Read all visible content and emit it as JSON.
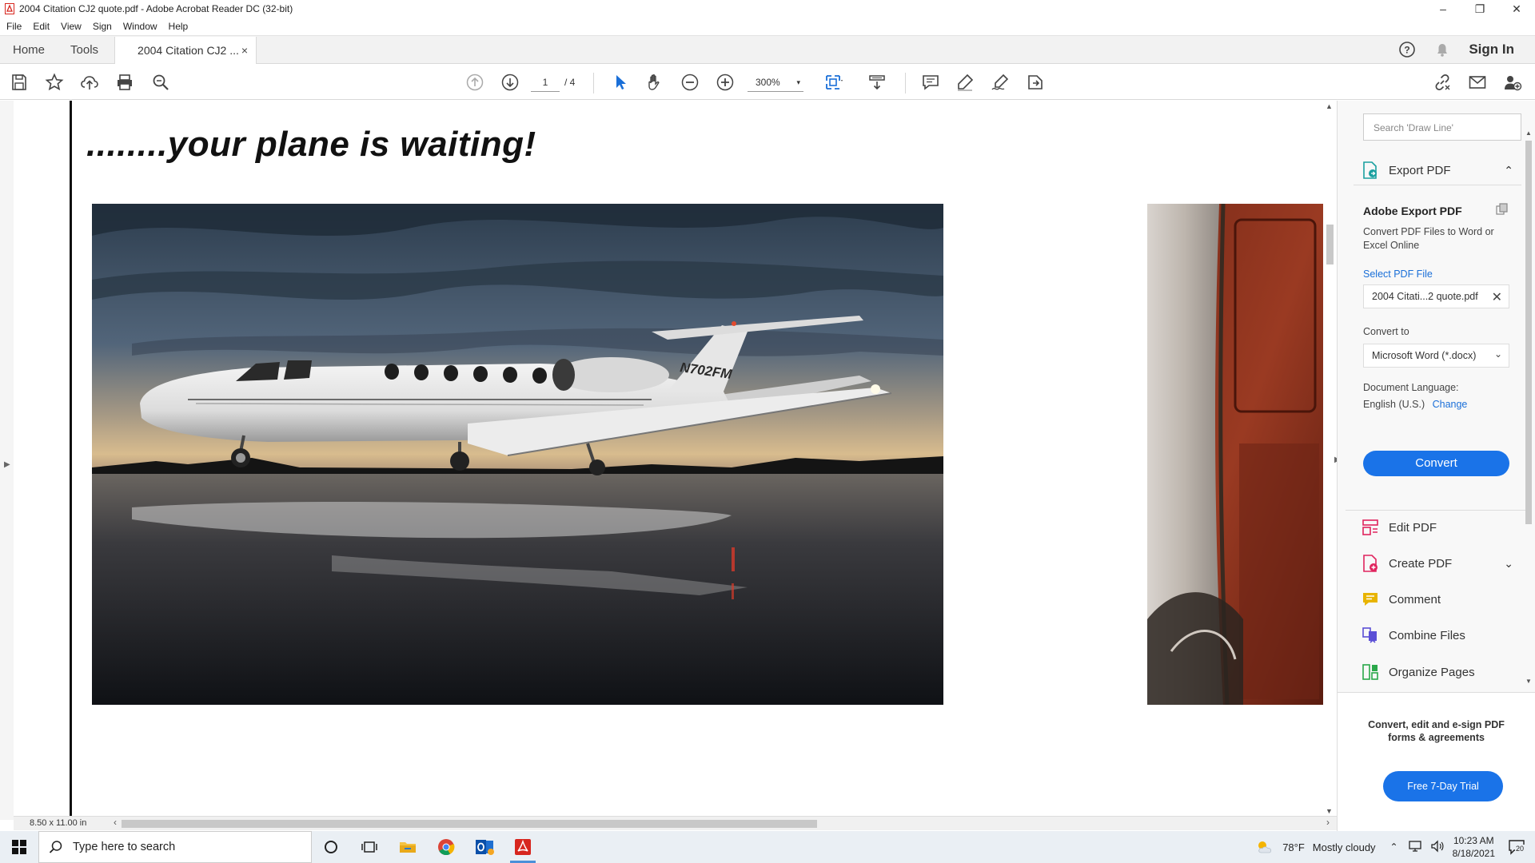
{
  "window": {
    "title": "2004 Citation CJ2 quote.pdf - Adobe Acrobat Reader DC (32-bit)",
    "minimize": "–",
    "maximize": "❐",
    "close": "✕"
  },
  "menu": [
    "File",
    "Edit",
    "View",
    "Sign",
    "Window",
    "Help"
  ],
  "tabs": {
    "home": "Home",
    "tools": "Tools",
    "document": "2004 Citation CJ2 ...",
    "close": "×",
    "sign_in": "Sign In"
  },
  "toolbar": {
    "page_current": "1",
    "page_total": "/ 4",
    "zoom": "300%",
    "zoom_caret": "▾"
  },
  "document": {
    "heading": "........your plane is waiting!",
    "tail_number": "N702FM",
    "page_size": "8.50 x 11.00 in"
  },
  "right_pane": {
    "search_placeholder": "Search 'Draw Line'",
    "export_header": "Export PDF",
    "export_title": "Adobe Export PDF",
    "export_desc": "Convert PDF Files to Word or Excel Online",
    "select_file": "Select PDF File",
    "file_name": "2004 Citati...2 quote.pdf",
    "convert_to_label": "Convert to",
    "format": "Microsoft Word (*.docx)",
    "language_label": "Document Language:",
    "language_value": "English (U.S.)",
    "language_change": "Change",
    "convert_button": "Convert",
    "tools": [
      {
        "label": "Edit PDF",
        "icon": "edit-pdf-icon",
        "color": "#e0245e"
      },
      {
        "label": "Create PDF",
        "icon": "create-pdf-icon",
        "color": "#e0245e"
      },
      {
        "label": "Comment",
        "icon": "comment-icon",
        "color": "#e8b400"
      },
      {
        "label": "Combine Files",
        "icon": "combine-files-icon",
        "color": "#5b4fd6"
      },
      {
        "label": "Organize Pages",
        "icon": "organize-pages-icon",
        "color": "#2aa84a"
      }
    ],
    "promo_text": "Convert, edit and e-sign PDF forms & agreements",
    "trial_button": "Free 7-Day Trial"
  },
  "taskbar": {
    "search_placeholder": "Type here to search",
    "weather_temp": "78°F",
    "weather_desc": "Mostly cloudy",
    "time": "10:23 AM",
    "date": "8/18/2021",
    "notification_count": "20"
  },
  "colors": {
    "accent": "#1a73e8",
    "link": "#1a6fd8",
    "acrobat_red": "#d7261e"
  }
}
